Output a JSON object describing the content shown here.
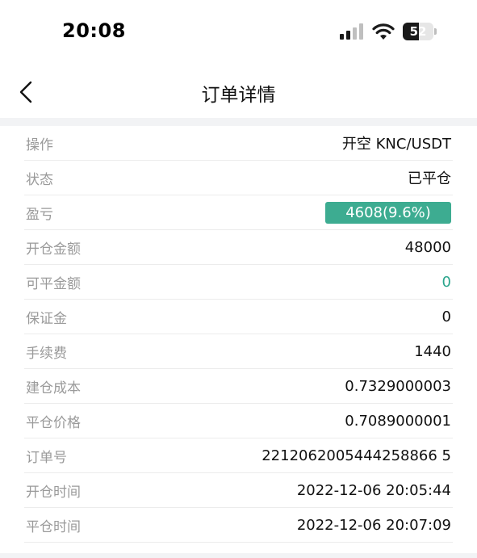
{
  "status_bar": {
    "time": "20:08",
    "battery_level": "52",
    "battery_fraction": 0.52,
    "icons": [
      "cellular-signal-icon",
      "wifi-icon",
      "battery-icon"
    ]
  },
  "nav": {
    "back_icon": "chevron-left-icon",
    "title": "订单详情"
  },
  "colors": {
    "accent_green": "#3dac91",
    "value_green": "#2aa58c",
    "label_gray": "#9a9a9a",
    "band_gray": "#f2f3f5"
  },
  "details": {
    "operation": {
      "label": "操作",
      "value": "开空 KNC/USDT"
    },
    "status": {
      "label": "状态",
      "value": "已平仓"
    },
    "pnl": {
      "label": "盈亏",
      "value": "4608(9.6%)"
    },
    "open_amount": {
      "label": "开仓金额",
      "value": "48000"
    },
    "closable_amount": {
      "label": "可平金额",
      "value": "0"
    },
    "margin": {
      "label": "保证金",
      "value": "0"
    },
    "fee": {
      "label": "手续费",
      "value": "1440"
    },
    "entry_cost": {
      "label": "建仓成本",
      "value": "0.7329000003"
    },
    "close_price": {
      "label": "平仓价格",
      "value": "0.7089000001"
    },
    "order_no": {
      "label": "订单号",
      "value": "2212062005444258866 5"
    },
    "open_time": {
      "label": "开仓时间",
      "value": "2022-12-06 20:05:44"
    },
    "close_time": {
      "label": "平仓时间",
      "value": "2022-12-06 20:07:09"
    }
  }
}
